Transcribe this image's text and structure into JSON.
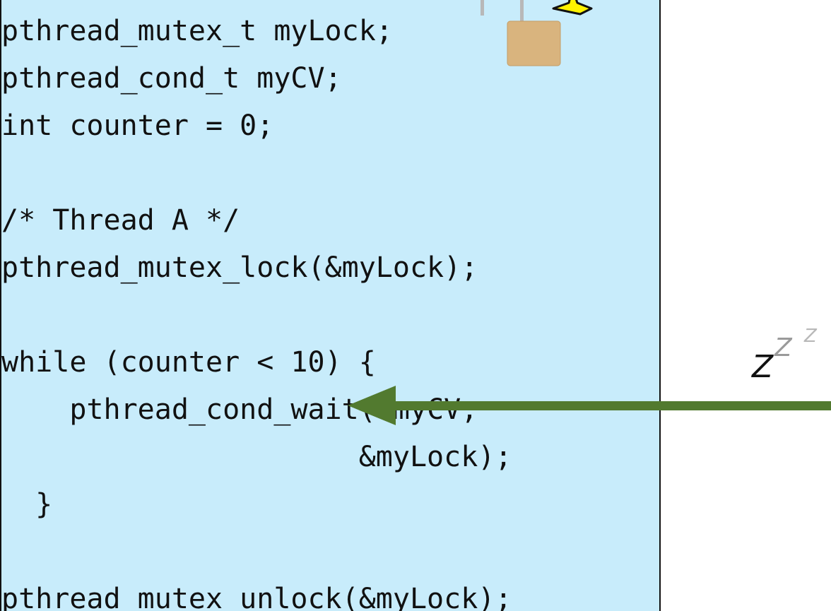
{
  "code": {
    "lines": [
      "pthread_mutex_t myLock;",
      "pthread_cond_t myCV;",
      "int counter = 0;",
      "",
      "/* Thread A */",
      "pthread_mutex_lock(&myLock);",
      "",
      "while (counter < 10) {",
      "    pthread_cond_wait(&myCV,",
      "                     &myLock);",
      "  }",
      "",
      "pthread_mutex_unlock(&myLock);"
    ]
  },
  "annotations": {
    "sleep_text": "Z",
    "sleep_text_2": "Z",
    "sleep_text_3": "Z"
  },
  "icons": {
    "lock": "padlock-icon",
    "star": "star-icon",
    "arrow": "arrow-left-icon"
  },
  "colors": {
    "panel_bg": "#c8ecfb",
    "arrow": "#527a2f",
    "lock_body": "#d9b47e",
    "star_fill": "#fff200"
  }
}
